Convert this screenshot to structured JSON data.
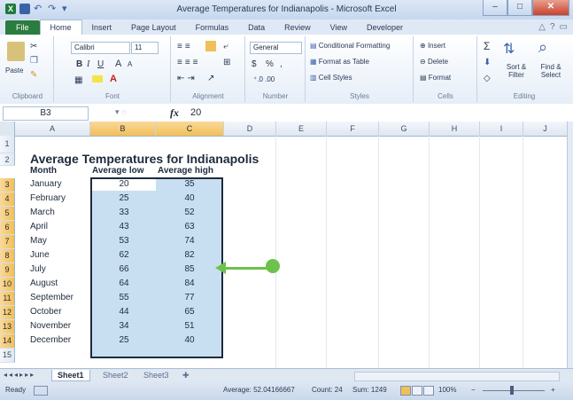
{
  "window": {
    "title": "Average Temperatures for Indianapolis - Microsoft Excel",
    "minimize": "–",
    "maximize": "□",
    "close": "✕"
  },
  "qat": {
    "app_icon": "X",
    "undo": "↶",
    "redo": "↷",
    "customize": "▾"
  },
  "ribbon_tabs": [
    "File",
    "Home",
    "Insert",
    "Page Layout",
    "Formulas",
    "Data",
    "Review",
    "View",
    "Developer"
  ],
  "ribbon": {
    "clipboard": {
      "paste": "Paste",
      "label": "Clipboard"
    },
    "font": {
      "name": "Calibri",
      "size": "11",
      "bold": "B",
      "italic": "I",
      "underline": "U",
      "grow": "A",
      "shrink": "A",
      "label": "Font"
    },
    "alignment": {
      "label": "Alignment"
    },
    "number": {
      "format": "General",
      "currency": "$",
      "percent": "%",
      "comma": ",",
      "label": "Number"
    },
    "styles": {
      "conditional": "Conditional Formatting",
      "table": "Format as Table",
      "cell_styles": "Cell Styles",
      "label": "Styles"
    },
    "cells": {
      "insert": "Insert",
      "delete": "Delete",
      "format": "Format",
      "label": "Cells"
    },
    "editing": {
      "sum": "Σ",
      "sort": "Sort & Filter",
      "find": "Find & Select",
      "label": "Editing"
    }
  },
  "formula_bar": {
    "name_box": "B3",
    "fx": "fx",
    "value": "20"
  },
  "columns": [
    "A",
    "B",
    "C",
    "D",
    "E",
    "F",
    "G",
    "H",
    "I",
    "J"
  ],
  "rows": [
    "1",
    "2",
    "3",
    "4",
    "5",
    "6",
    "7",
    "8",
    "9",
    "10",
    "11",
    "12",
    "13",
    "14",
    "15"
  ],
  "sheet": {
    "title": "Average Temperatures for Indianapolis",
    "headers": {
      "month": "Month",
      "low": "Average low",
      "high": "Average high"
    },
    "data": [
      {
        "month": "January",
        "low": "20",
        "high": "35"
      },
      {
        "month": "February",
        "low": "25",
        "high": "40"
      },
      {
        "month": "March",
        "low": "33",
        "high": "52"
      },
      {
        "month": "April",
        "low": "43",
        "high": "63"
      },
      {
        "month": "May",
        "low": "53",
        "high": "74"
      },
      {
        "month": "June",
        "low": "62",
        "high": "82"
      },
      {
        "month": "July",
        "low": "66",
        "high": "85"
      },
      {
        "month": "August",
        "low": "64",
        "high": "84"
      },
      {
        "month": "September",
        "low": "55",
        "high": "77"
      },
      {
        "month": "October",
        "low": "44",
        "high": "65"
      },
      {
        "month": "November",
        "low": "34",
        "high": "51"
      },
      {
        "month": "December",
        "low": "25",
        "high": "40"
      }
    ]
  },
  "sheet_tabs": [
    "Sheet1",
    "Sheet2",
    "Sheet3"
  ],
  "status": {
    "ready": "Ready",
    "average": "Average: 52.04166667",
    "count": "Count: 24",
    "sum": "Sum: 1249",
    "zoom": "100%",
    "zoom_out": "−",
    "zoom_in": "+"
  },
  "colors": {
    "accent": "#6cc24a",
    "selection": "#c8dff2",
    "file_tab": "#2a7c3f"
  }
}
